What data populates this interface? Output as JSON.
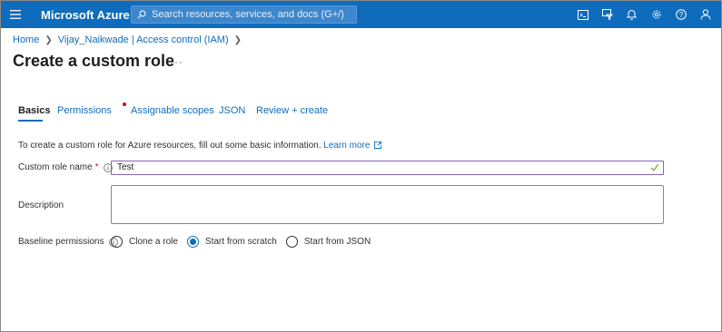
{
  "topbar": {
    "brand": "Microsoft Azure",
    "search_placeholder": "Search resources, services, and docs (G+/)",
    "icons": [
      "hamburger-icon",
      "search-icon",
      "cloud-shell-icon",
      "directory-filter-icon",
      "notifications-icon",
      "settings-icon",
      "help-icon",
      "feedback-icon"
    ],
    "color": "#0f6cbd"
  },
  "breadcrumb": {
    "items": [
      "Home",
      "Vijay_Naikwade | Access control (IAM)"
    ]
  },
  "page": {
    "title": "Create a custom role",
    "more": "···"
  },
  "tabs": [
    {
      "label": "Basics",
      "active": true
    },
    {
      "label": "Permissions",
      "required": true
    },
    {
      "label": "Assignable scopes"
    },
    {
      "label": "JSON"
    },
    {
      "label": "Review + create"
    }
  ],
  "form": {
    "intro_text": "To create a custom role for Azure resources, fill out some basic information.",
    "learn_more": "Learn more",
    "custom_role_name_label": "Custom role name",
    "required_marker": "*",
    "custom_role_name_value": "Test",
    "description_label": "Description",
    "description_value": "",
    "baseline_label": "Baseline permissions",
    "baseline_options": [
      "Clone a role",
      "Start from scratch",
      "Start from JSON"
    ],
    "baseline_selected": "Start from scratch"
  }
}
